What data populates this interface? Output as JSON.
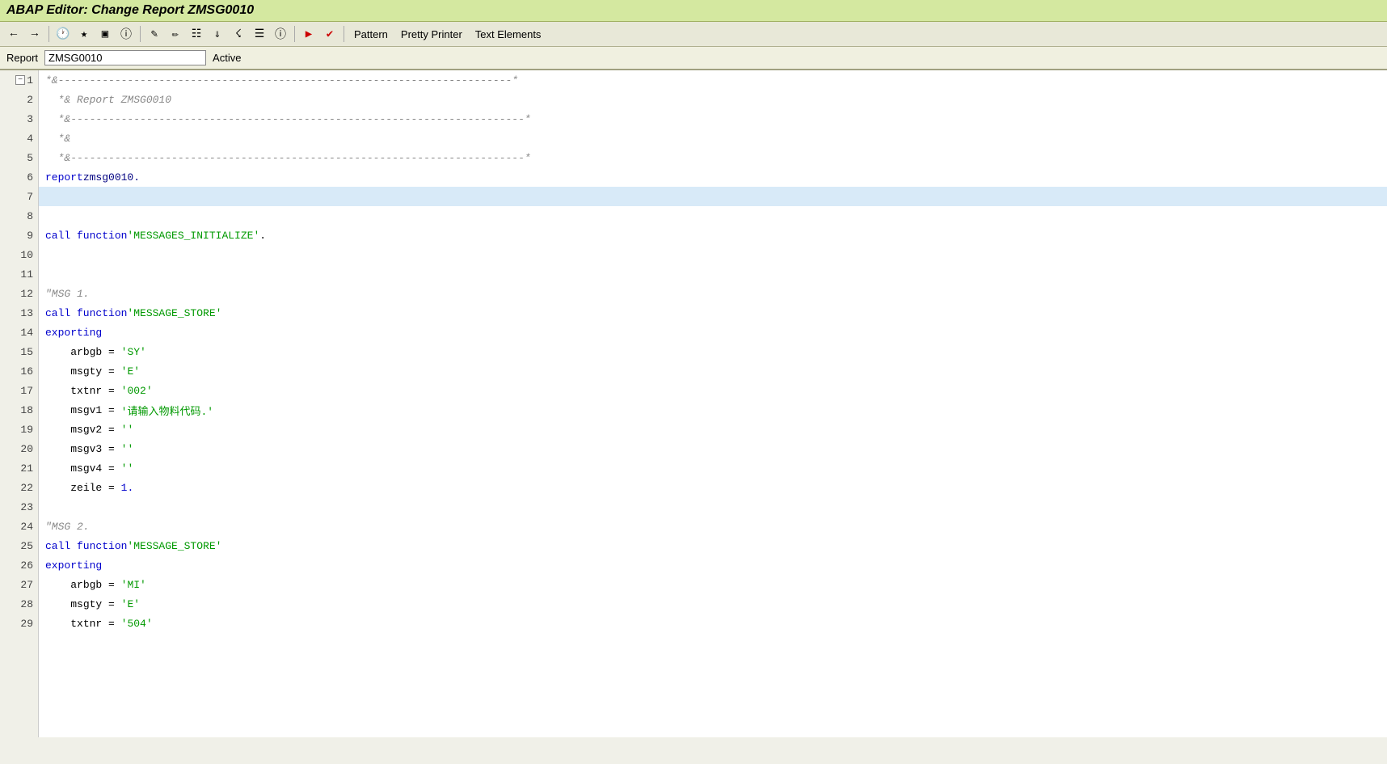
{
  "title": "ABAP Editor: Change Report ZMSG0010",
  "toolbar": {
    "buttons": [
      "Pattern",
      "Pretty Printer",
      "Text Elements"
    ]
  },
  "report_bar": {
    "label": "Report",
    "name": "ZMSG0010",
    "status": "Active"
  },
  "lines": [
    {
      "num": 1,
      "collapse": true,
      "content": "*&------------------------------------------------------------------------*"
    },
    {
      "num": 2,
      "content": "  *& Report ZMSG0010"
    },
    {
      "num": 3,
      "content": "  *&------------------------------------------------------------------------*"
    },
    {
      "num": 4,
      "content": "  *&"
    },
    {
      "num": 5,
      "content": "  *&------------------------------------------------------------------------*"
    },
    {
      "num": 6,
      "content": "report zmsg0010."
    },
    {
      "num": 7,
      "content": "",
      "highlight": true
    },
    {
      "num": 8,
      "content": ""
    },
    {
      "num": 9,
      "content": "call function 'MESSAGES_INITIALIZE'."
    },
    {
      "num": 10,
      "content": ""
    },
    {
      "num": 11,
      "content": ""
    },
    {
      "num": 12,
      "content": "\"MSG 1."
    },
    {
      "num": 13,
      "content": "call function 'MESSAGE_STORE'"
    },
    {
      "num": 14,
      "content": "  exporting"
    },
    {
      "num": 15,
      "content": "    arbgb = 'SY'"
    },
    {
      "num": 16,
      "content": "    msgty = 'E'"
    },
    {
      "num": 17,
      "content": "    txtnr = '002'"
    },
    {
      "num": 18,
      "content": "    msgv1 = '请输入物料代码.'"
    },
    {
      "num": 19,
      "content": "    msgv2 = ''"
    },
    {
      "num": 20,
      "content": "    msgv3 = ''"
    },
    {
      "num": 21,
      "content": "    msgv4 = ''"
    },
    {
      "num": 22,
      "content": "    zeile = 1."
    },
    {
      "num": 23,
      "content": ""
    },
    {
      "num": 24,
      "content": "\"MSG 2."
    },
    {
      "num": 25,
      "content": "call function 'MESSAGE_STORE'"
    },
    {
      "num": 26,
      "content": "  exporting"
    },
    {
      "num": 27,
      "content": "    arbgb = 'MI'"
    },
    {
      "num": 28,
      "content": "    msgty = 'E'"
    },
    {
      "num": 29,
      "content": "    txtnr = '504'"
    }
  ]
}
